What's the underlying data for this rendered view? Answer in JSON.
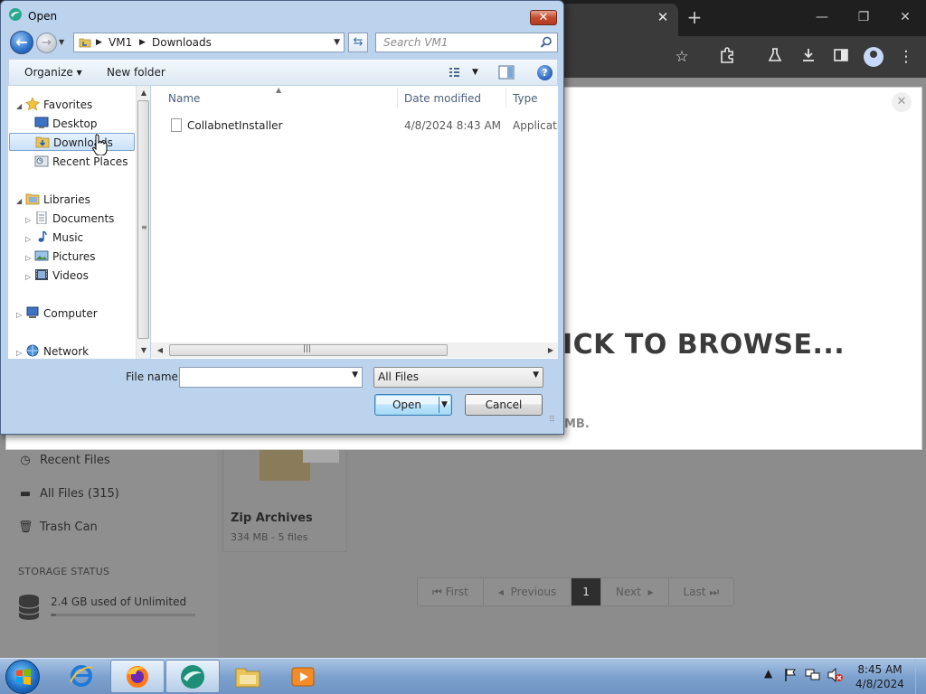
{
  "browser": {
    "tab_close": "✕",
    "new_tab": "+",
    "window_controls": [
      "—",
      "❐",
      "✕"
    ],
    "toolbar_icons": [
      "star-icon",
      "extensions-icon",
      "labs-icon",
      "download-icon",
      "sidepanel-icon",
      "profile-icon",
      "menu-icon"
    ]
  },
  "page": {
    "sidebar": {
      "items": [
        {
          "label": "Recent Files",
          "icon": "clock-icon"
        },
        {
          "label": "All Files (315)",
          "icon": "files-icon"
        },
        {
          "label": "Trash Can",
          "icon": "trash-icon"
        }
      ],
      "storage_label": "STORAGE STATUS",
      "storage_text": "2.4 GB used of Unlimited"
    },
    "folder": {
      "title": "Zip Archives",
      "subtitle": "334 MB - 5 files"
    },
    "pager": [
      "First",
      "Previous",
      "1",
      "Next",
      "Last"
    ],
    "pager_active": "1",
    "modal": {
      "close": "✕",
      "dropzone_text": "ICK TO BROWSE...",
      "dropzone_sub": "MB."
    }
  },
  "dialog": {
    "title": "Open",
    "close": "✕",
    "address": {
      "segments": [
        "VM1",
        "Downloads"
      ]
    },
    "search_placeholder": "Search VM1",
    "commands": {
      "organize": "Organize ▾",
      "new_folder": "New folder"
    },
    "nav_tree": {
      "favorites": "Favorites",
      "desktop": "Desktop",
      "downloads": "Downloads",
      "recent_places": "Recent Places",
      "libraries": "Libraries",
      "documents": "Documents",
      "music": "Music",
      "pictures": "Pictures",
      "videos": "Videos",
      "computer": "Computer",
      "network": "Network"
    },
    "columns": {
      "name": "Name",
      "date_modified": "Date modified",
      "type": "Type"
    },
    "files": [
      {
        "name": "CollabnetInstaller",
        "date_modified": "4/8/2024 8:43 AM",
        "type": "Applicatio"
      }
    ],
    "file_name_label": "File name:",
    "file_name_value": "",
    "filter": "All Files",
    "open_label": "Open",
    "cancel_label": "Cancel"
  },
  "taskbar": {
    "time": "8:45 AM",
    "date": "4/8/2024"
  }
}
